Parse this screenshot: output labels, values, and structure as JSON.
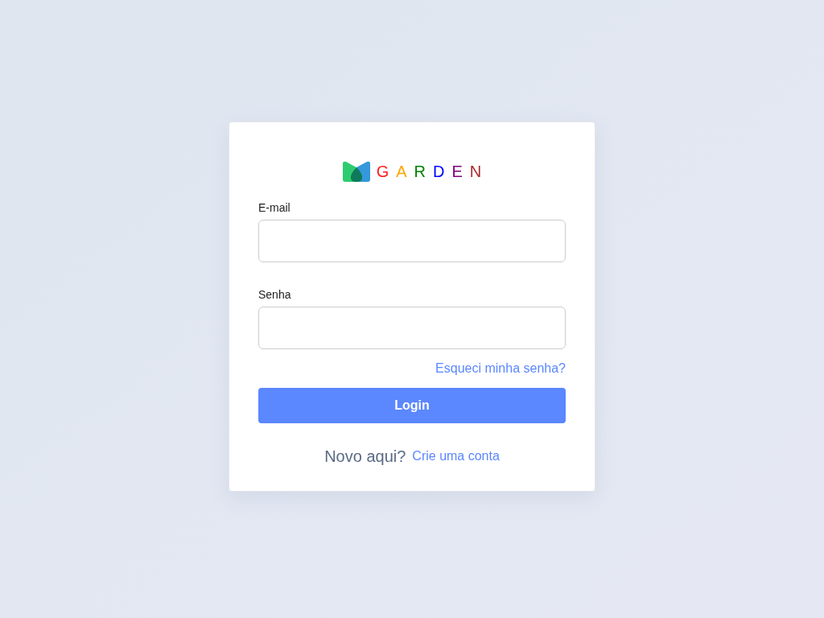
{
  "logo": {
    "letters": [
      {
        "text": "G",
        "color": "#ff1f1f"
      },
      {
        "text": "A",
        "color": "#ffa500"
      },
      {
        "text": "R",
        "color": "#008000"
      },
      {
        "text": "D",
        "color": "#0000ff"
      },
      {
        "text": "E",
        "color": "#800080"
      },
      {
        "text": "N",
        "color": "#a52a2a"
      }
    ]
  },
  "fields": [
    {
      "label": "E-mail"
    },
    {
      "label": "Senha"
    }
  ],
  "forgot_link": "Esqueci minha senha?",
  "login_button": "Login",
  "signup": {
    "prompt": "Novo aqui?",
    "link": "Crie uma conta"
  }
}
